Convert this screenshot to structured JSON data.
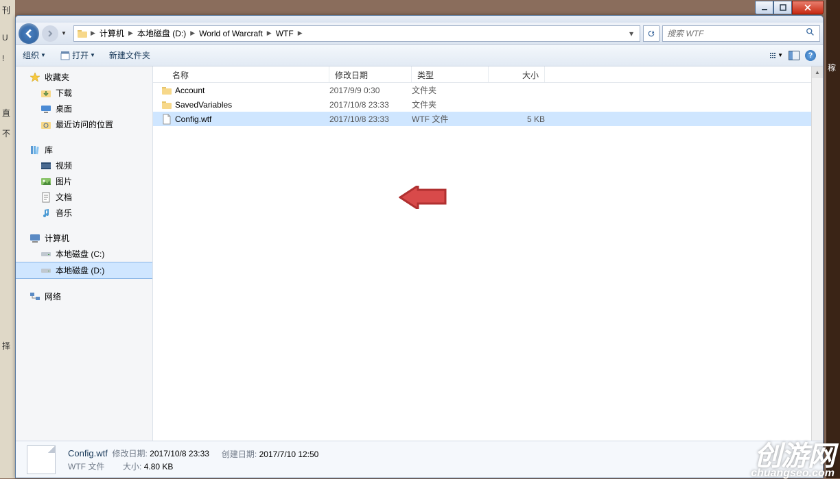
{
  "bg_fragments": [
    "刊",
    "U",
    "!",
    "直",
    "不",
    "择"
  ],
  "bg_right": "稼",
  "breadcrumbs": [
    "计算机",
    "本地磁盘 (D:)",
    "World of Warcraft",
    "WTF"
  ],
  "search_placeholder": "搜索 WTF",
  "toolbar": {
    "organize": "组织",
    "open": "打开",
    "new_folder": "新建文件夹"
  },
  "sidebar": {
    "favorites": {
      "label": "收藏夹",
      "items": [
        "下载",
        "桌面",
        "最近访问的位置"
      ]
    },
    "libraries": {
      "label": "库",
      "items": [
        "视频",
        "图片",
        "文档",
        "音乐"
      ]
    },
    "computer": {
      "label": "计算机",
      "items": [
        "本地磁盘 (C:)",
        "本地磁盘 (D:)"
      ],
      "selected_index": 1
    },
    "network": {
      "label": "网络"
    }
  },
  "columns": {
    "name": "名称",
    "date": "修改日期",
    "type": "类型",
    "size": "大小"
  },
  "rows": [
    {
      "name": "Account",
      "date": "2017/9/9 0:30",
      "type": "文件夹",
      "size": "",
      "icon": "folder",
      "selected": false
    },
    {
      "name": "SavedVariables",
      "date": "2017/10/8 23:33",
      "type": "文件夹",
      "size": "",
      "icon": "folder",
      "selected": false
    },
    {
      "name": "Config.wtf",
      "date": "2017/10/8 23:33",
      "type": "WTF 文件",
      "size": "5 KB",
      "icon": "file",
      "selected": true
    }
  ],
  "details": {
    "title": "Config.wtf",
    "subtitle": "WTF 文件",
    "mod_label": "修改日期:",
    "mod_value": "2017/10/8 23:33",
    "size_label": "大小:",
    "size_value": "4.80 KB",
    "create_label": "创建日期:",
    "create_value": "2017/7/10 12:50"
  },
  "watermark": {
    "big": "创游网",
    "small": "chuangseo.com"
  }
}
